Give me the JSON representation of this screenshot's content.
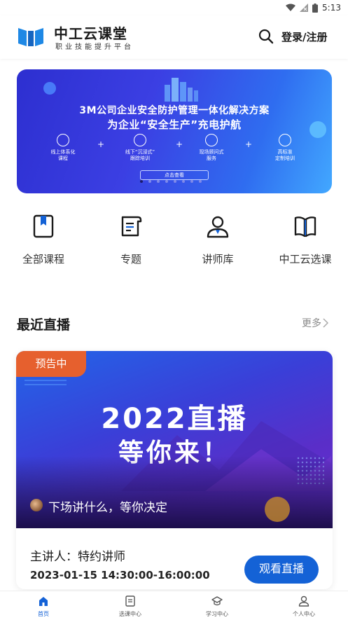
{
  "status_bar": {
    "time": "5:13"
  },
  "header": {
    "brand_title": "中工云课堂",
    "brand_subtitle": "职业技能提升平台",
    "login_label": "登录/注册"
  },
  "banner": {
    "line1": "3M公司企业安全防护管理一体化解决方案",
    "line2": "为企业“安全生产”充电护航",
    "features": [
      "线上体系化\n课程",
      "线下“沉浸式”\n跟踪培训",
      "现场顾问式\n服务",
      "高标准\n定制培训"
    ],
    "cta": "点击查看",
    "slides_total": 8,
    "active_slide": 1
  },
  "quick_nav": [
    {
      "label": "全部课程",
      "icon": "bookmark-book-icon"
    },
    {
      "label": "专题",
      "icon": "document-icon"
    },
    {
      "label": "讲师库",
      "icon": "teacher-icon"
    },
    {
      "label": "中工云选课",
      "icon": "open-book-icon"
    }
  ],
  "recent_live": {
    "title": "最近直播",
    "more_label": "更多"
  },
  "live_card": {
    "badge": "预告中",
    "poster_line1": "2022直播",
    "poster_line2": "等你来！",
    "caption": "下场讲什么，等你决定",
    "speaker": "主讲人：特约讲师",
    "time": "2023-01-15 14:30:00-16:00:00",
    "watch_label": "观看直播"
  },
  "tabbar": {
    "items": [
      {
        "label": "首页",
        "icon": "home-icon",
        "active": true
      },
      {
        "label": "选课中心",
        "icon": "course-select-icon",
        "active": false
      },
      {
        "label": "学习中心",
        "icon": "graduation-cap-icon",
        "active": false
      },
      {
        "label": "个人中心",
        "icon": "user-icon",
        "active": false
      }
    ]
  },
  "colors": {
    "accent": "#1462d6",
    "badge": "#e6602e"
  }
}
